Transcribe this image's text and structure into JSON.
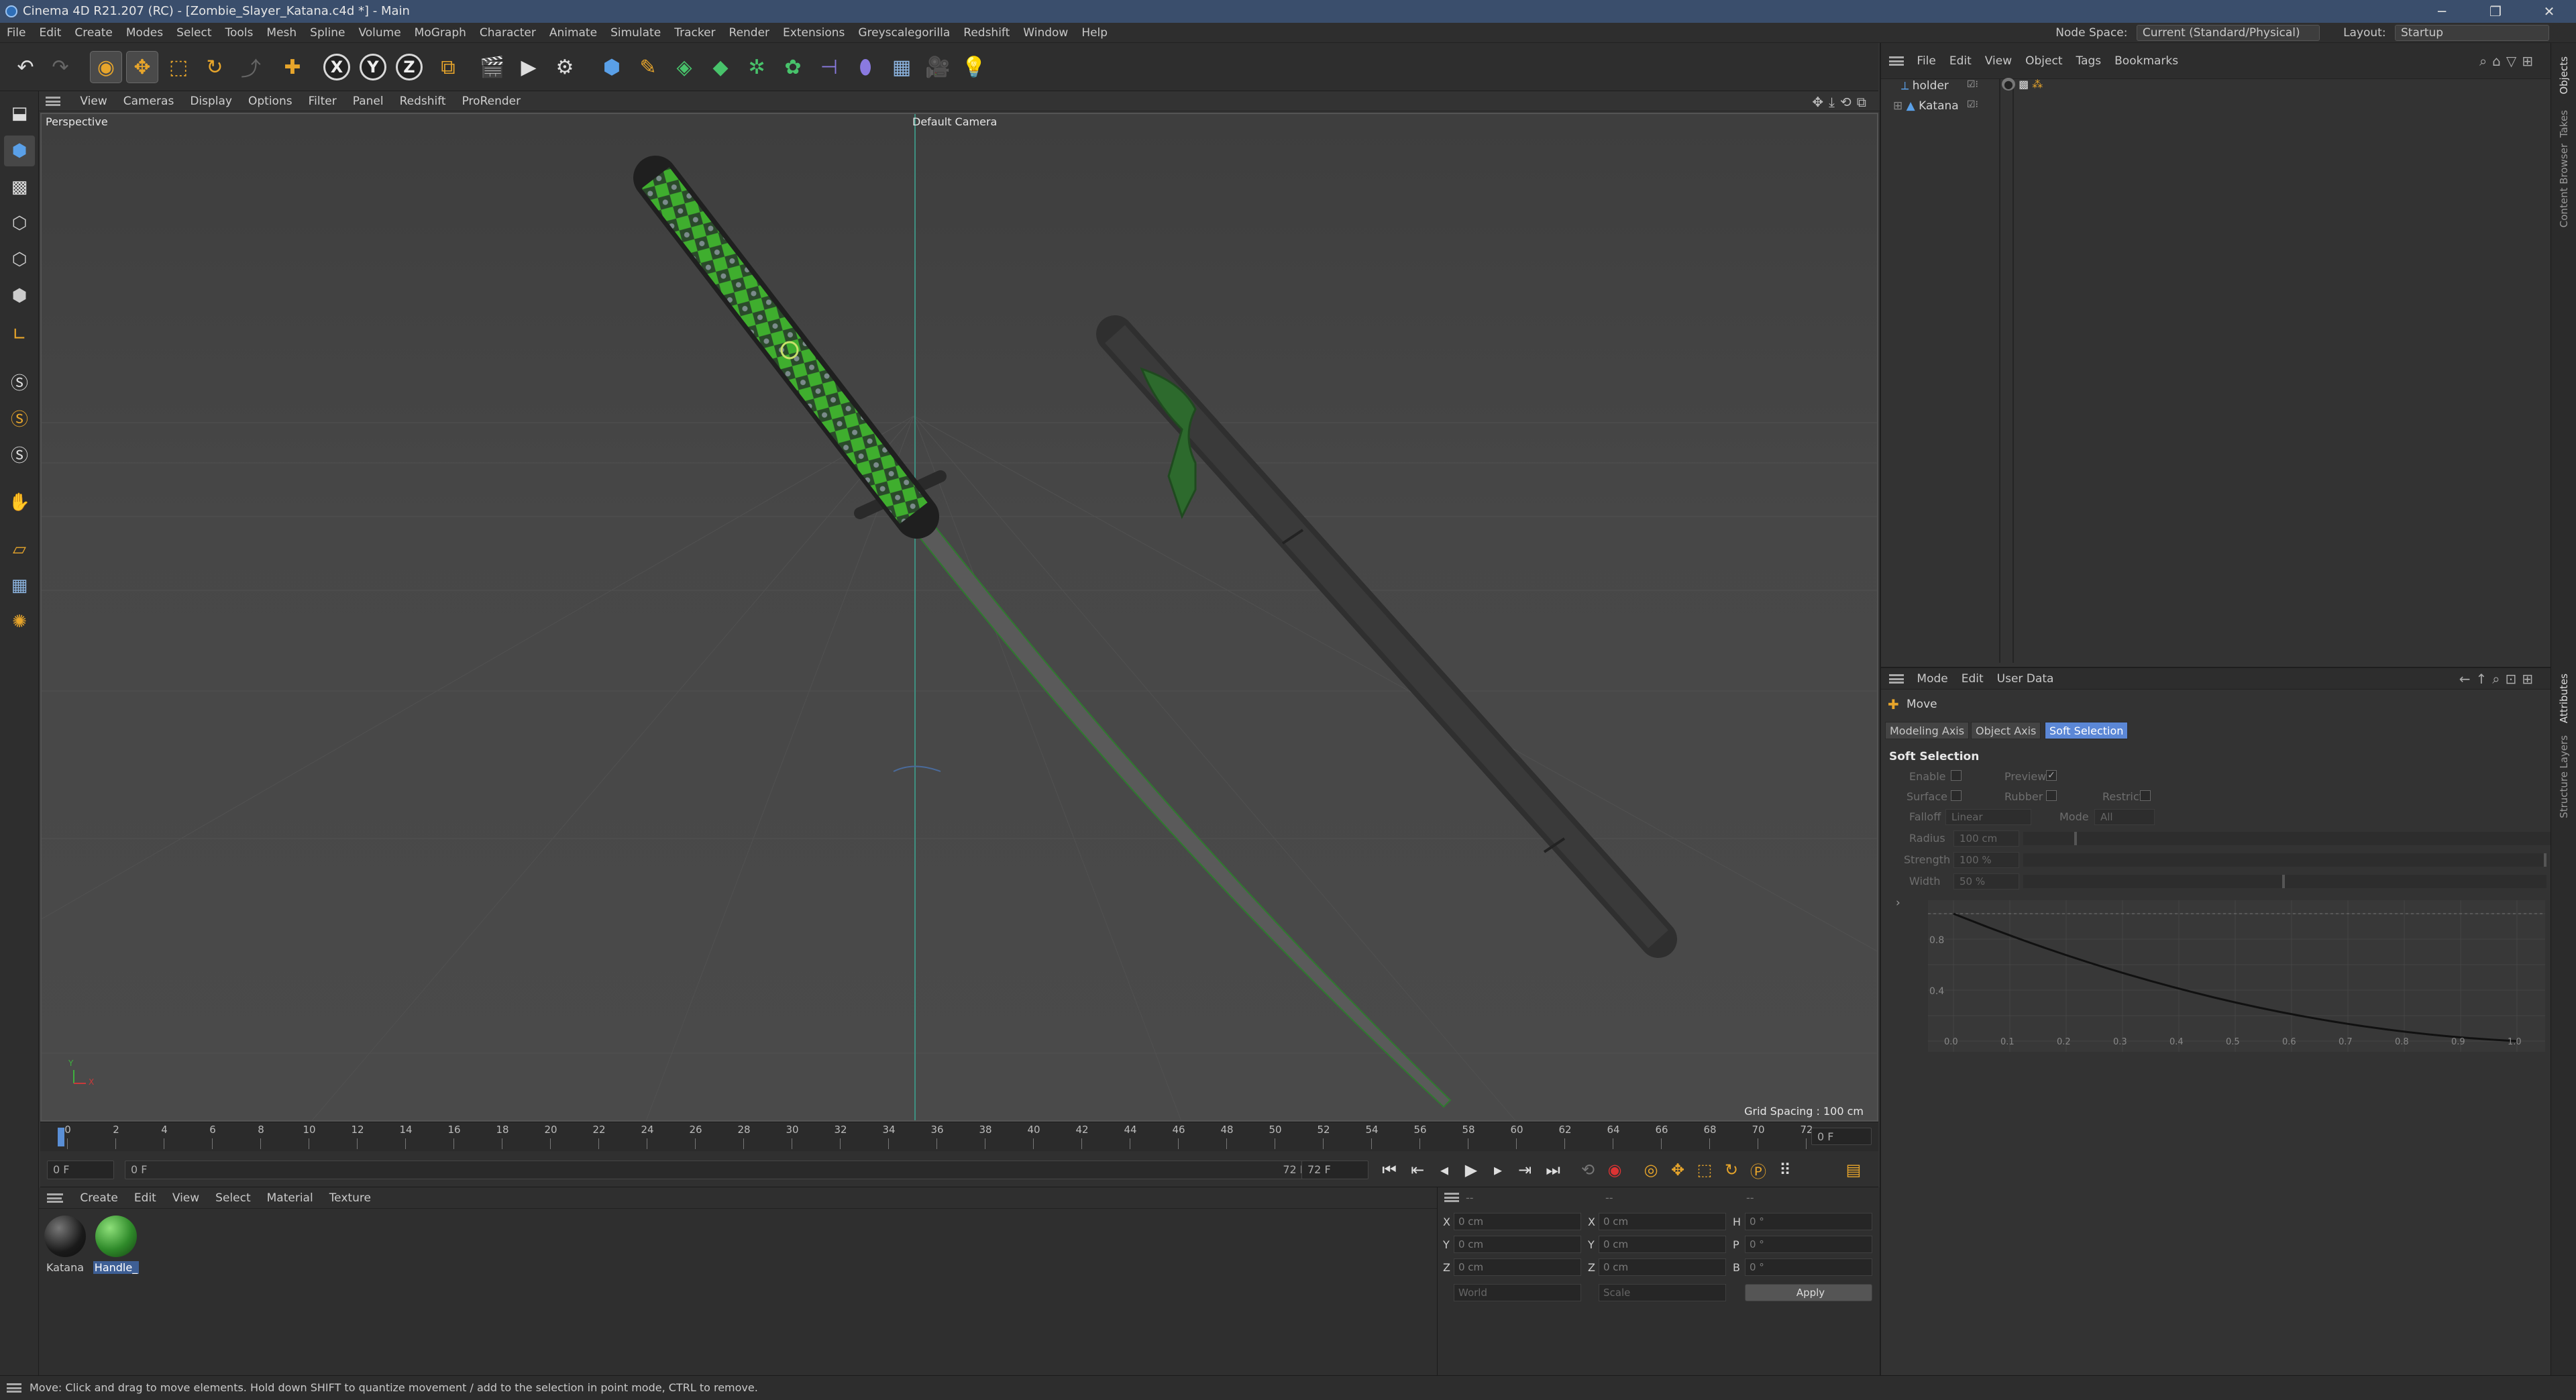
{
  "window": {
    "title": "Cinema 4D R21.207 (RC) - [Zombie_Slayer_Katana.c4d *] - Main",
    "min": "─",
    "max": "❐",
    "close": "✕"
  },
  "menubar": {
    "items": [
      "File",
      "Edit",
      "Create",
      "Modes",
      "Select",
      "Tools",
      "Mesh",
      "Spline",
      "Volume",
      "MoGraph",
      "Character",
      "Animate",
      "Simulate",
      "Tracker",
      "Render",
      "Extensions",
      "Greyscalegorilla",
      "Redshift",
      "Window",
      "Help"
    ],
    "node_space_label": "Node Space:",
    "node_space_value": "Current (Standard/Physical)",
    "layout_label": "Layout:",
    "layout_value": "Startup"
  },
  "toolbar": {
    "undo_icon": "undo-icon",
    "x_label": "X",
    "y_label": "Y",
    "z_label": "Z"
  },
  "viewport": {
    "menu": [
      "View",
      "Cameras",
      "Display",
      "Options",
      "Filter",
      "Panel",
      "Redshift",
      "ProRender"
    ],
    "mode_label": "Perspective",
    "camera_label": "Default Camera",
    "grid_spacing": "Grid Spacing : 100 cm",
    "axis_y": "Y",
    "axis_x": "X"
  },
  "timeline": {
    "ticks": [
      "0",
      "2",
      "4",
      "6",
      "8",
      "10",
      "12",
      "14",
      "16",
      "18",
      "20",
      "22",
      "24",
      "26",
      "28",
      "30",
      "32",
      "34",
      "36",
      "38",
      "40",
      "42",
      "44",
      "46",
      "48",
      "50",
      "52",
      "54",
      "56",
      "58",
      "60",
      "62",
      "64",
      "66",
      "68",
      "70",
      "72"
    ],
    "current_frame": "0 F",
    "start_field": "0 F",
    "range_start": "0 F",
    "range_end": "72 F",
    "end_field": "72 F"
  },
  "materials": {
    "menu": [
      "Create",
      "Edit",
      "View",
      "Select",
      "Material",
      "Texture"
    ],
    "items": [
      {
        "name": "Katana",
        "color": "#1e1e1e"
      },
      {
        "name": "Handle_",
        "color": "#2f8a2a"
      }
    ]
  },
  "coordinates": {
    "rows": [
      {
        "a": "X",
        "av": "0 cm",
        "b": "X",
        "bv": "0 cm",
        "c": "H",
        "cv": "0 °"
      },
      {
        "a": "Y",
        "av": "0 cm",
        "b": "Y",
        "bv": "0 cm",
        "c": "P",
        "cv": "0 °"
      },
      {
        "a": "Z",
        "av": "0 cm",
        "b": "Z",
        "bv": "0 cm",
        "c": "B",
        "cv": "0 °"
      }
    ],
    "header_dashes": "--",
    "mode1": "World",
    "mode2": "Scale",
    "apply": "Apply"
  },
  "objects": {
    "menu": [
      "File",
      "Edit",
      "View",
      "Object",
      "Tags",
      "Bookmarks"
    ],
    "items": [
      {
        "name": "holder"
      },
      {
        "name": "Katana"
      }
    ]
  },
  "attributes": {
    "menu": [
      "Mode",
      "Edit",
      "User Data"
    ],
    "tool_name": "Move",
    "tabs": [
      "Modeling Axis",
      "Object Axis",
      "Soft Selection"
    ],
    "section": "Soft Selection",
    "enable": "Enable",
    "preview": "Preview",
    "surface": "Surface",
    "rubber": "Rubber",
    "restrict": "Restrict",
    "falloff": "Falloff",
    "falloff_value": "Linear",
    "mode": "Mode",
    "mode_value": "All",
    "radius": "Radius",
    "radius_value": "100 cm",
    "strength": "Strength",
    "strength_value": "100 %",
    "width": "Width",
    "width_value": "50 %",
    "graph_y": [
      "0.8",
      "0.4"
    ],
    "graph_x": [
      "0.0",
      "0.1",
      "0.2",
      "0.3",
      "0.4",
      "0.5",
      "0.6",
      "0.7",
      "0.8",
      "0.9",
      "1.0"
    ]
  },
  "side_tabs": [
    "Objects",
    "Takes",
    "Content Browser",
    "Attributes",
    "Layers",
    "Structure"
  ],
  "status": "Move: Click and drag to move elements. Hold down SHIFT to quantize movement / add to the selection in point mode, CTRL to remove."
}
